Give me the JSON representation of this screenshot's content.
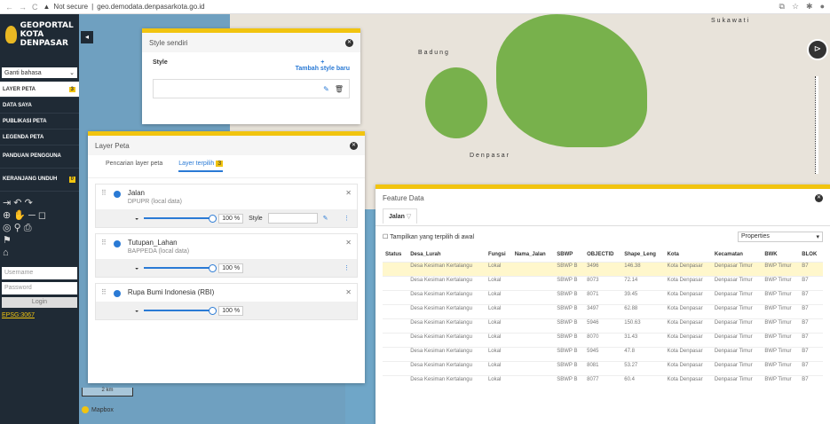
{
  "browser": {
    "url_prefix": "Not secure",
    "url": "geo.demodata.denpasarkota.go.id"
  },
  "sidebar": {
    "logo_line1": "GEOPORTAL",
    "logo_line2": "KOTA DENPASAR",
    "language_select": "Ganti bahasa",
    "items": [
      {
        "label": "LAYER PETA",
        "badge": "3"
      },
      {
        "label": "DATA SAYA"
      },
      {
        "label": "PUBLIKASI PETA"
      },
      {
        "label": "LEGENDA PETA"
      },
      {
        "label": "PANDUAN PENGGUNA"
      },
      {
        "label": "KERANJANG UNDUH",
        "badge": "0"
      }
    ],
    "username_placeholder": "Username",
    "password_placeholder": "Password",
    "login_label": "Login",
    "epsg": "EPSG:3067"
  },
  "style_panel": {
    "title": "Style sendiri",
    "style_label": "Style",
    "add_label": "Tambah style baru"
  },
  "layer_panel": {
    "title": "Layer Peta",
    "tab_search": "Pencarian layer peta",
    "tab_selected": "Layer terpilih",
    "selected_count": "3",
    "layers": [
      {
        "name": "Jalan",
        "source": "DPUPR (local data)",
        "opacity": "100 %",
        "style_label": "Style"
      },
      {
        "name": "Tutupan_Lahan",
        "source": "BAPPEDA (local data)",
        "opacity": "100 %"
      },
      {
        "name": "Rupa Bumi Indonesia (RBI)",
        "source": "",
        "opacity": "100 %"
      }
    ]
  },
  "map": {
    "scale": "2 km",
    "attribution": "Mapbox"
  },
  "feature_panel": {
    "title": "Feature Data",
    "tab": "Jalan",
    "show_selected": "Tampilkan yang terpilih di awal",
    "properties": "Properties",
    "columns": [
      "Status",
      "Desa_Lurah",
      "Fungsi",
      "Nama_Jalan",
      "SBWP",
      "OBJECTID",
      "Shape_Leng",
      "Kota",
      "Kecamatan",
      "BWK",
      "BLOK"
    ],
    "rows": [
      [
        "",
        "Desa Kesiman Kertalangu",
        "Lokal",
        "",
        "SBWP B",
        "3496",
        "146.38",
        "Kota Denpasar",
        "Denpasar Timur",
        "BWP Timur",
        "B7"
      ],
      [
        "",
        "Desa Kesiman Kertalangu",
        "Lokal",
        "",
        "SBWP B",
        "8073",
        "72.14",
        "Kota Denpasar",
        "Denpasar Timur",
        "BWP Timur",
        "B7"
      ],
      [
        "",
        "Desa Kesiman Kertalangu",
        "Lokal",
        "",
        "SBWP B",
        "8071",
        "39.45",
        "Kota Denpasar",
        "Denpasar Timur",
        "BWP Timur",
        "B7"
      ],
      [
        "",
        "Desa Kesiman Kertalangu",
        "Lokal",
        "",
        "SBWP B",
        "3497",
        "62.88",
        "Kota Denpasar",
        "Denpasar Timur",
        "BWP Timur",
        "B7"
      ],
      [
        "",
        "Desa Kesiman Kertalangu",
        "Lokal",
        "",
        "SBWP B",
        "5946",
        "150.63",
        "Kota Denpasar",
        "Denpasar Timur",
        "BWP Timur",
        "B7"
      ],
      [
        "",
        "Desa Kesiman Kertalangu",
        "Lokal",
        "",
        "SBWP B",
        "8070",
        "31.43",
        "Kota Denpasar",
        "Denpasar Timur",
        "BWP Timur",
        "B7"
      ],
      [
        "",
        "Desa Kesiman Kertalangu",
        "Lokal",
        "",
        "SBWP B",
        "5945",
        "47.8",
        "Kota Denpasar",
        "Denpasar Timur",
        "BWP Timur",
        "B7"
      ],
      [
        "",
        "Desa Kesiman Kertalangu",
        "Lokal",
        "",
        "SBWP B",
        "8081",
        "53.27",
        "Kota Denpasar",
        "Denpasar Timur",
        "BWP Timur",
        "B7"
      ],
      [
        "",
        "Desa Kesiman Kertalangu",
        "Lokal",
        "",
        "SBWP B",
        "8077",
        "60.4",
        "Kota Denpasar",
        "Denpasar Timur",
        "BWP Timur",
        "B7"
      ]
    ]
  }
}
